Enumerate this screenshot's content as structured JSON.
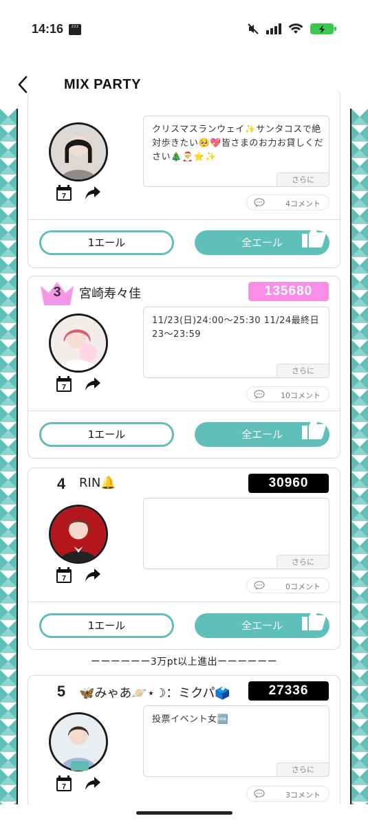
{
  "status_bar": {
    "time": "14:16",
    "sleep_badge": "zzz"
  },
  "nav": {
    "title": "MIX PARTY"
  },
  "cards": [
    {
      "rank": "",
      "name": "",
      "points": "",
      "message": "クリスマスランウェイ✨サンタコスで絶対歩きたい🥺💖皆さまのお力お貸しください🎄🎅⭐✨",
      "more_label": "さらに",
      "comments": "4コメント",
      "one_cheer": "1エール",
      "all_cheer": "全エール",
      "calendar_day": "7"
    },
    {
      "rank": "3",
      "name": "宮崎寿々佳",
      "points": "135680",
      "message": "11/23(日)24:00〜25:30 11/24最終日23〜23:59",
      "more_label": "さらに",
      "comments": "10コメント",
      "one_cheer": "1エール",
      "all_cheer": "全エール",
      "calendar_day": "7"
    },
    {
      "rank": "4",
      "name": "RIN🔔",
      "points": "30960",
      "message": "",
      "more_label": "さらに",
      "comments": "0コメント",
      "one_cheer": "1エール",
      "all_cheer": "全エール",
      "calendar_day": "7"
    },
    {
      "rank": "5",
      "name": "🦋みゃあ🪐⋆☽：ミクパ🗳️",
      "points": "27336",
      "message": "投票イベント女🆒",
      "more_label": "さらに",
      "comments": "3コメント",
      "calendar_day": "7"
    }
  ],
  "separator": "ーーーーーー3万pt以上進出ーーーーーー",
  "colors": {
    "accent": "#5fbfb9",
    "pink_badge": "#f98ee6",
    "black_badge": "#000000"
  }
}
